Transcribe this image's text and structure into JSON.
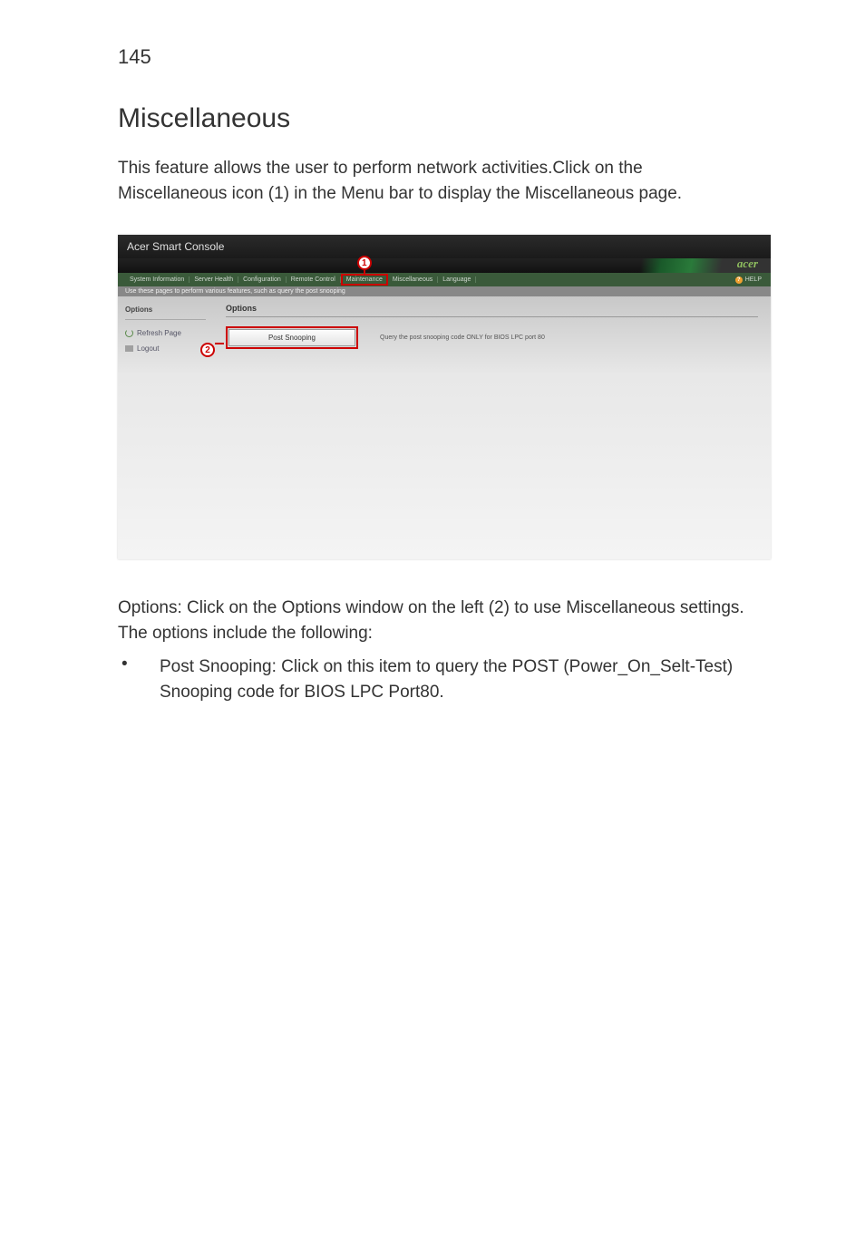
{
  "page_number": "145",
  "heading": "Miscellaneous",
  "intro_text": "This feature allows the user to perform network activities.Click on the Miscellaneous icon (1) in the Menu bar to display the Miscellaneous page.",
  "screenshot": {
    "title": "Acer Smart Console",
    "brand": "acer",
    "menubar": {
      "items": [
        "System Information",
        "Server Health",
        "Configuration",
        "Remote Control",
        "Maintenance",
        "Miscellaneous",
        "Language"
      ],
      "highlighted": "Maintenance"
    },
    "help_label": "HELP",
    "help_icon_char": "?",
    "sub_text": "Use these pages to perform various features, such as query the post snooping",
    "sidebar": {
      "heading": "Options",
      "refresh": "Refresh Page",
      "logout": "Logout"
    },
    "main": {
      "heading": "Options",
      "button_label": "Post Snooping",
      "button_desc": "Query the post snooping code ONLY for BIOS LPC port 80"
    },
    "callouts": {
      "one": "1",
      "two": "2"
    }
  },
  "options_text": "Options: Click on the Options window on the left (2) to use Miscellaneous settings. The options include the following:",
  "bullet": "•",
  "bullet_text": "Post Snooping: Click on this item to query the POST (Power_On_Selt-Test) Snooping code for BIOS LPC Port80."
}
